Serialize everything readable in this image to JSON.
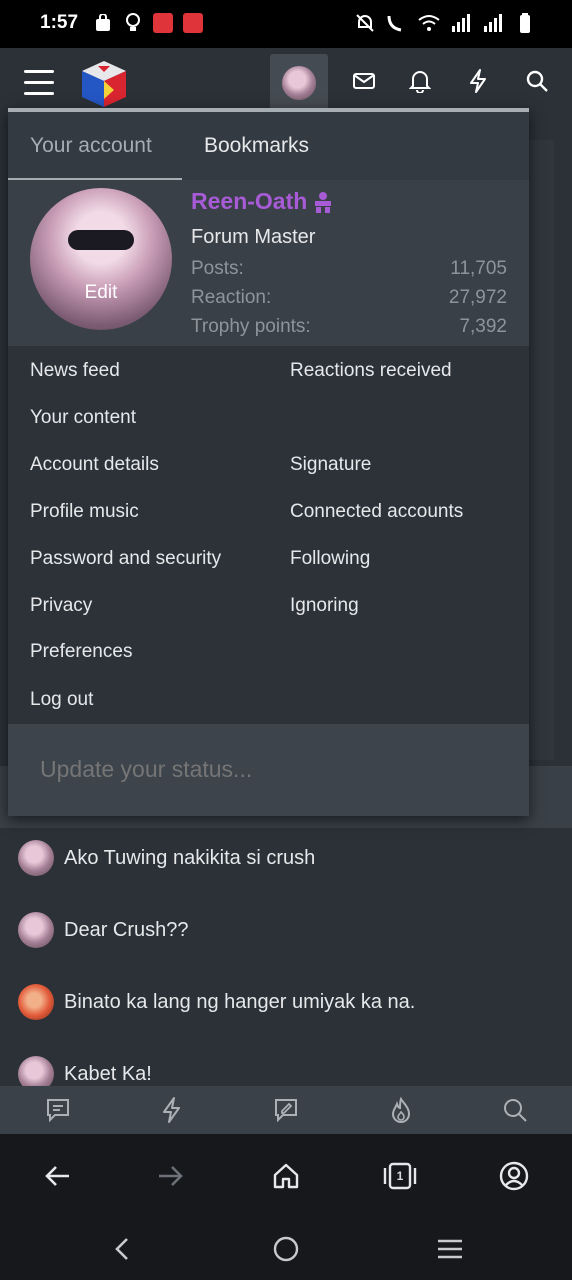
{
  "status_bar": {
    "time": "1:57"
  },
  "dropdown": {
    "tabs": [
      {
        "label": "Your account"
      },
      {
        "label": "Bookmarks"
      }
    ],
    "profile": {
      "avatar_edit_label": "Edit",
      "username": "Reen-Oath",
      "user_title": "Forum Master",
      "stats": [
        {
          "label": "Posts:",
          "value": "11,705"
        },
        {
          "label": "Reaction:",
          "value": "27,972"
        },
        {
          "label": "Trophy points:",
          "value": "7,392"
        }
      ]
    },
    "links": {
      "news_feed": "News feed",
      "reactions_received": "Reactions received",
      "your_content": "Your content",
      "account_details": "Account details",
      "signature": "Signature",
      "profile_music": "Profile music",
      "connected_accounts": "Connected accounts",
      "password_security": "Password and security",
      "following": "Following",
      "privacy": "Privacy",
      "ignoring": "Ignoring",
      "preferences": "Preferences",
      "log_out": "Log out"
    },
    "status_placeholder": "Update your status..."
  },
  "threads": [
    {
      "title": "Ako Tuwing nakikita si crush"
    },
    {
      "title": "Dear Crush??"
    },
    {
      "title": "Binato ka lang ng hanger umiyak ka na."
    },
    {
      "title": "Kabet Ka!"
    }
  ],
  "browser": {
    "tab_count": "1"
  },
  "colors": {
    "username": "#a85bd6",
    "header_bg": "#2b3137",
    "panel_bg": "#2d3239"
  }
}
